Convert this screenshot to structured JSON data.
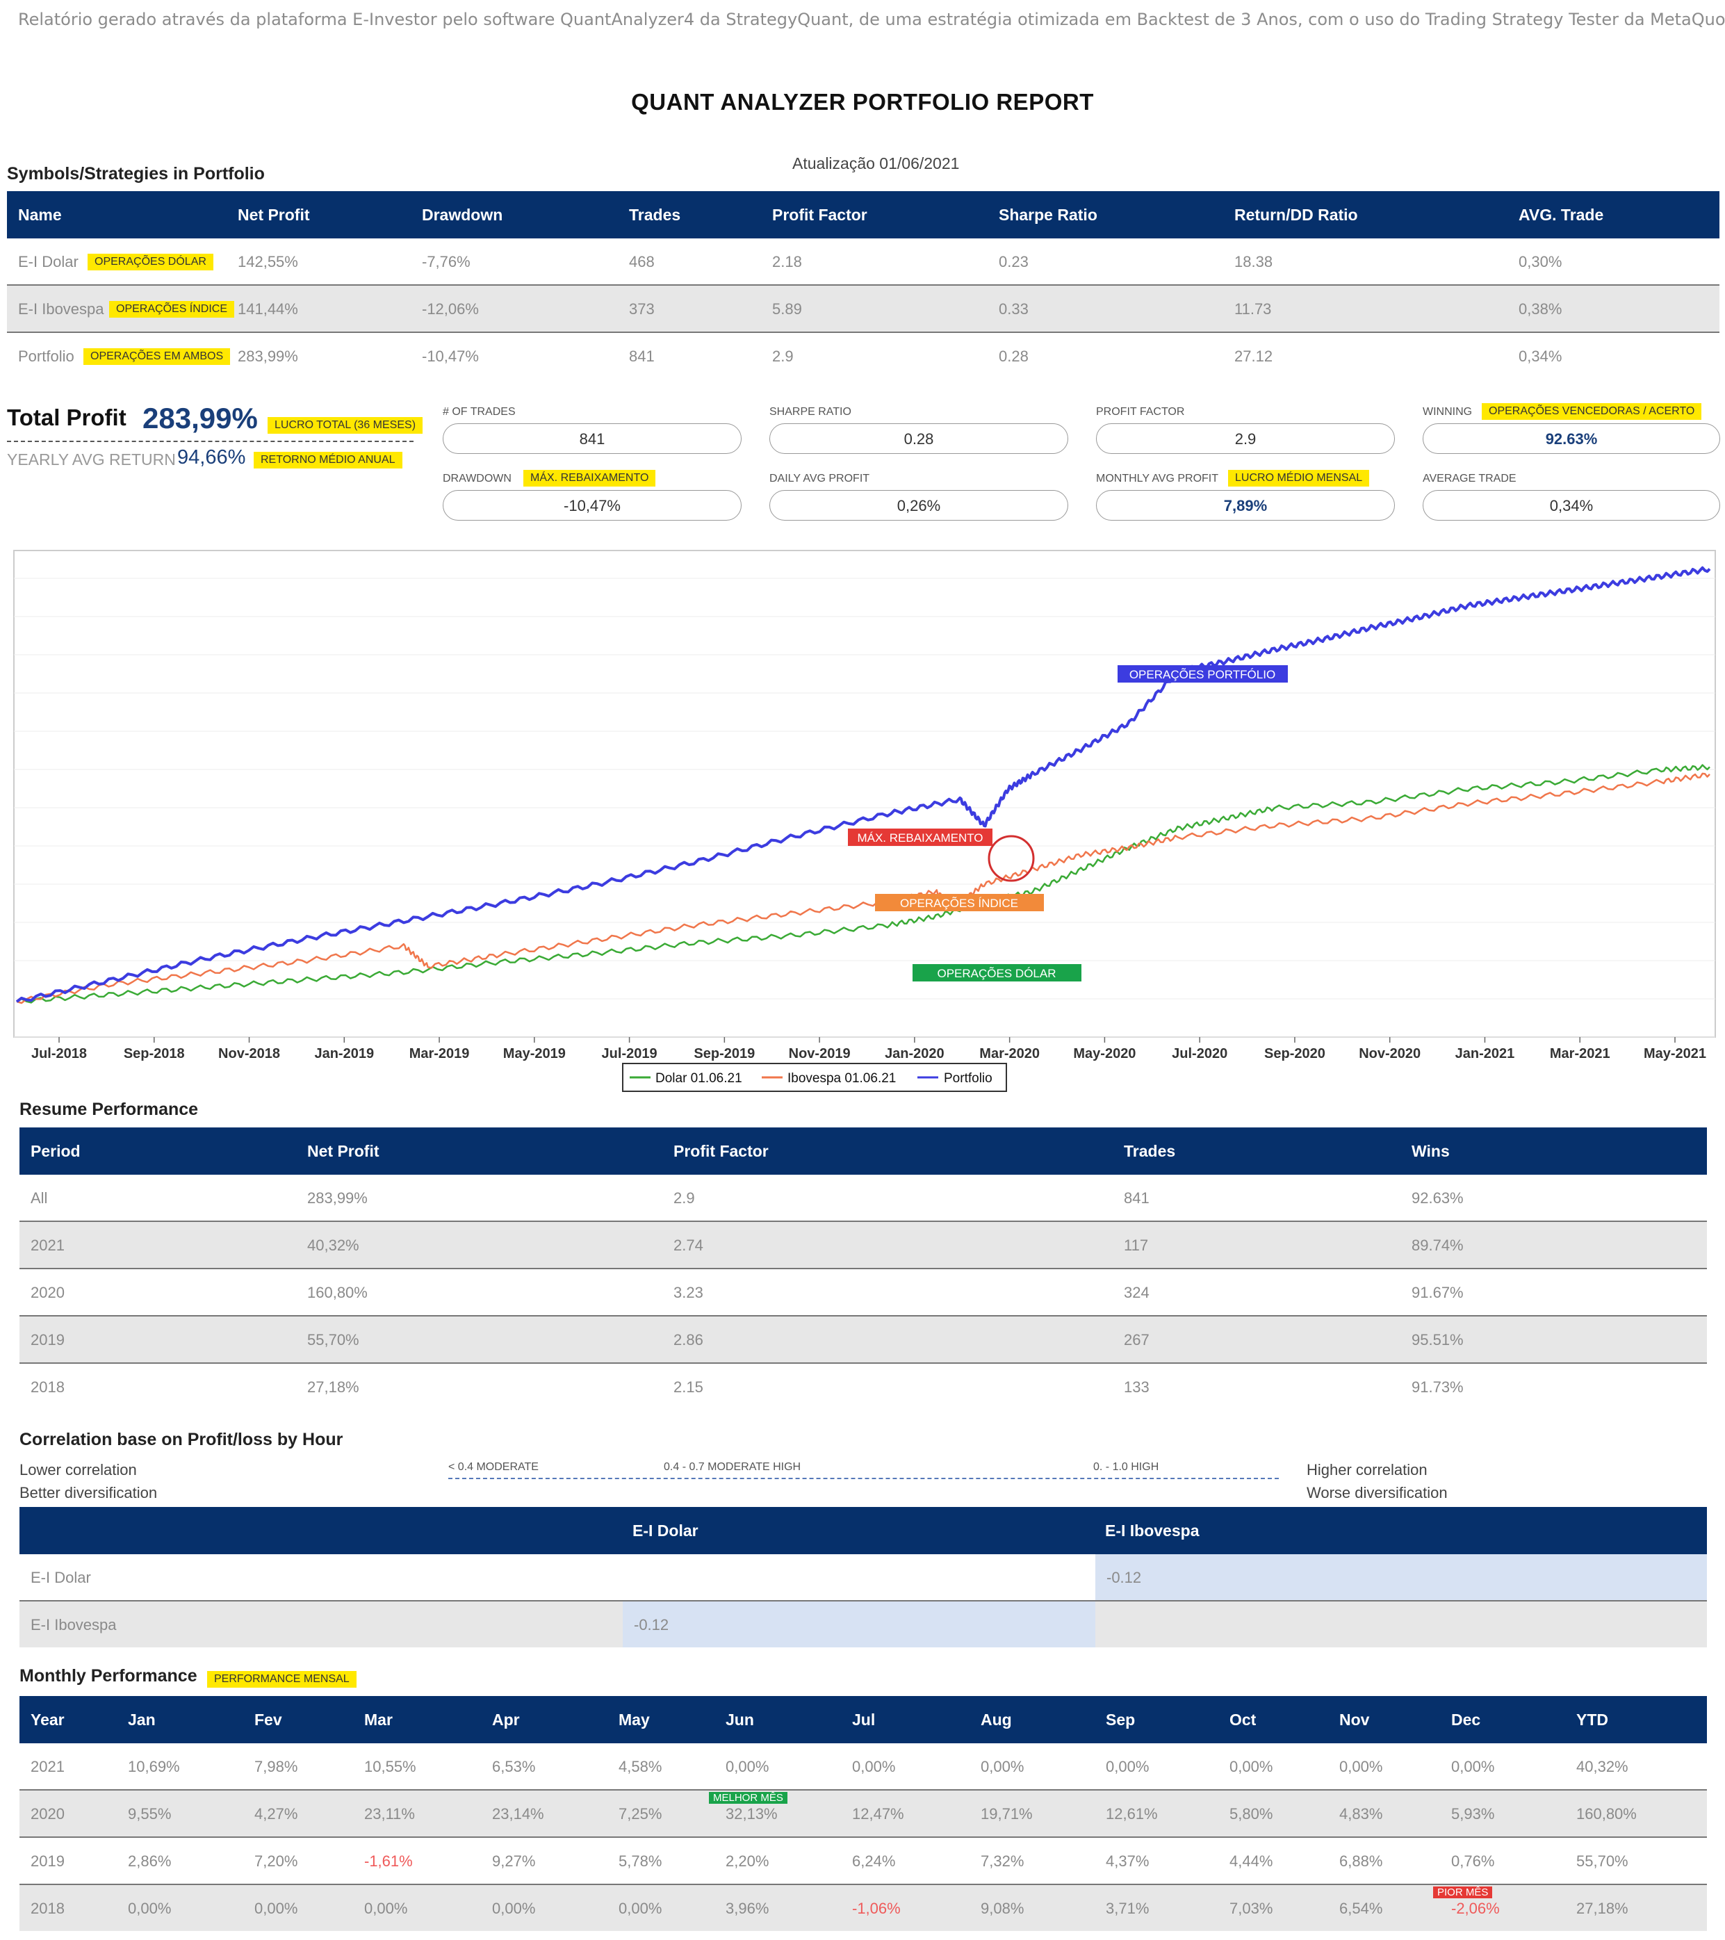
{
  "top_note": "Relatório gerado através da plataforma E-Investor pelo software QuantAnalyzer4 da StrategyQuant, de uma estratégia otimizada em Backtest de 3 Anos, com o uso do Trading Strategy Tester da MetaQuotes.",
  "report_title": "QUANT ANALYZER PORTFOLIO REPORT",
  "update_label": "Atualização 01/06/2021",
  "symbols_section": {
    "title": "Symbols/Strategies in Portfolio",
    "headers": [
      "Name",
      "Net Profit",
      "Drawdown",
      "Trades",
      "Profit Factor",
      "Sharpe Ratio",
      "Return/DD Ratio",
      "AVG. Trade"
    ],
    "rows": [
      {
        "name": "E-I Dolar",
        "tag": "OPERAÇÕES DÓLAR",
        "cells": [
          "142,55%",
          "-7,76%",
          "468",
          "2.18",
          "0.23",
          "18.38",
          "0,30%"
        ]
      },
      {
        "name": "E-I Ibovespa",
        "tag": "OPERAÇÕES ÍNDICE",
        "cells": [
          "141,44%",
          "-12,06%",
          "373",
          "5.89",
          "0.33",
          "11.73",
          "0,38%"
        ]
      },
      {
        "name": "Portfolio",
        "tag": "OPERAÇÕES EM AMBOS",
        "cells": [
          "283,99%",
          "-10,47%",
          "841",
          "2.9",
          "0.28",
          "27.12",
          "0,34%"
        ]
      }
    ]
  },
  "summary": {
    "total_profit_label": "Total Profit",
    "total_profit_value": "283,99%",
    "total_profit_tag": "LUCRO TOTAL (36 MESES)",
    "yearly_label": "YEARLY AVG RETURN",
    "yearly_value": "94,66%",
    "yearly_tag": "RETORNO MÉDIO ANUAL",
    "stats": [
      {
        "label": "# OF TRADES",
        "tag": "",
        "value": "841"
      },
      {
        "label": "SHARPE RATIO",
        "tag": "",
        "value": "0.28"
      },
      {
        "label": "PROFIT FACTOR",
        "tag": "",
        "value": "2.9"
      },
      {
        "label": "WINNING",
        "tag": "OPERAÇÕES VENCEDORAS / ACERTO",
        "value": "92.63%"
      },
      {
        "label": "DRAWDOWN",
        "tag": "MÁX. REBAIXAMENTO",
        "value": "-10,47%"
      },
      {
        "label": "DAILY AVG PROFIT",
        "tag": "",
        "value": "0,26%"
      },
      {
        "label": "MONTHLY AVG PROFIT",
        "tag": "LUCRO MÉDIO MENSAL",
        "value": "7,89%"
      },
      {
        "label": "AVERAGE TRADE",
        "tag": "",
        "value": "0,34%"
      }
    ]
  },
  "chart_data": {
    "type": "line",
    "x_ticks": [
      "Jul-2018",
      "Sep-2018",
      "Nov-2018",
      "Jan-2019",
      "Mar-2019",
      "May-2019",
      "Jul-2019",
      "Sep-2019",
      "Nov-2019",
      "Jan-2020",
      "Mar-2020",
      "May-2020",
      "Jul-2020",
      "Sep-2020",
      "Nov-2020",
      "Jan-2021",
      "Mar-2021",
      "May-2021"
    ],
    "x_range": [
      0,
      35
    ],
    "ylim": [
      -10,
      300
    ],
    "series": [
      {
        "name": "Dolar 01.06.21",
        "color": "#3aaa35",
        "x": [
          0,
          2,
          4,
          6,
          8,
          10,
          12,
          14,
          16,
          18,
          19,
          20,
          21,
          22,
          23,
          24,
          25,
          26,
          28,
          30,
          32,
          34,
          35
        ],
        "values": [
          0,
          5,
          10,
          15,
          20,
          27,
          33,
          40,
          45,
          52,
          58,
          68,
          75,
          90,
          105,
          118,
          125,
          132,
          136,
          145,
          150,
          158,
          160
        ]
      },
      {
        "name": "Ibovespa 01.06.21",
        "color": "#f0764b",
        "x": [
          0,
          2,
          4,
          6,
          8,
          8.5,
          10,
          12,
          14,
          16,
          18,
          19,
          19.4,
          20,
          21,
          22,
          23,
          24,
          26,
          28,
          30,
          32,
          34,
          35
        ],
        "values": [
          0,
          12,
          20,
          28,
          38,
          24,
          32,
          42,
          52,
          60,
          68,
          75,
          65,
          80,
          90,
          100,
          105,
          112,
          120,
          125,
          135,
          142,
          150,
          155
        ]
      },
      {
        "name": "Portfolio",
        "color": "#3c3ce0",
        "x": [
          0,
          2,
          4,
          6,
          8,
          10,
          12,
          14,
          16,
          18,
          19.5,
          20,
          20.5,
          21,
          22,
          23,
          24,
          25,
          26,
          27,
          28,
          29,
          30,
          31,
          32,
          33,
          34,
          35
        ],
        "values": [
          0,
          15,
          30,
          43,
          55,
          67,
          80,
          95,
          112,
          128,
          138,
          120,
          145,
          155,
          172,
          190,
          225,
          232,
          240,
          247,
          255,
          262,
          270,
          275,
          280,
          285,
          290,
          295
        ]
      }
    ],
    "legend": [
      "Dolar 01.06.21",
      "Ibovespa 01.06.21",
      "Portfolio"
    ],
    "annotations": [
      {
        "text": "OPERAÇÕES PORTFÓLIO",
        "color": "#3c3ce0"
      },
      {
        "text": "MÁX. REBAIXAMENTO",
        "color": "#e53935"
      },
      {
        "text": "OPERAÇÕES ÍNDICE",
        "color": "#f28a3a"
      },
      {
        "text": "OPERAÇÕES DÓLAR",
        "color": "#19a34a"
      }
    ]
  },
  "resume": {
    "title": "Resume Performance",
    "headers": [
      "Period",
      "Net Profit",
      "Profit Factor",
      "Trades",
      "Wins"
    ],
    "rows": [
      [
        "All",
        "283,99%",
        "2.9",
        "841",
        "92.63%"
      ],
      [
        "2021",
        "40,32%",
        "2.74",
        "117",
        "89.74%"
      ],
      [
        "2020",
        "160,80%",
        "3.23",
        "324",
        "91.67%"
      ],
      [
        "2019",
        "55,70%",
        "2.86",
        "267",
        "95.51%"
      ],
      [
        "2018",
        "27,18%",
        "2.15",
        "133",
        "91.73%"
      ]
    ]
  },
  "correlation": {
    "title": "Correlation base on Profit/loss by Hour",
    "lower_1": "Lower correlation",
    "lower_2": "Better diversification",
    "higher_1": "Higher correlation",
    "higher_2": "Worse diversification",
    "scale": [
      "< 0.4 MODERATE",
      "0.4 - 0.7 MODERATE HIGH",
      "0. - 1.0 HIGH"
    ],
    "headers": [
      "E-I Dolar",
      "E-I Ibovespa"
    ],
    "rows": [
      {
        "name": "E-I Dolar",
        "value": "-0.12"
      },
      {
        "name": "E-I Ibovespa",
        "value": "-0.12"
      }
    ]
  },
  "monthly": {
    "title": "Monthly Performance",
    "tag": "PERFORMANCE MENSAL",
    "headers": [
      "Year",
      "Jan",
      "Fev",
      "Mar",
      "Apr",
      "May",
      "Jun",
      "Jul",
      "Aug",
      "Sep",
      "Oct",
      "Nov",
      "Dec",
      "YTD"
    ],
    "rows": [
      [
        "2021",
        "10,69%",
        "7,98%",
        "10,55%",
        "6,53%",
        "4,58%",
        "0,00%",
        "0,00%",
        "0,00%",
        "0,00%",
        "0,00%",
        "0,00%",
        "0,00%",
        "40,32%"
      ],
      [
        "2020",
        "9,55%",
        "4,27%",
        "23,11%",
        "23,14%",
        "7,25%",
        "32,13%",
        "12,47%",
        "19,71%",
        "12,61%",
        "5,80%",
        "4,83%",
        "5,93%",
        "160,80%"
      ],
      [
        "2019",
        "2,86%",
        "7,20%",
        "-1,61%",
        "9,27%",
        "5,78%",
        "2,20%",
        "6,24%",
        "7,32%",
        "4,37%",
        "4,44%",
        "6,88%",
        "0,76%",
        "55,70%"
      ],
      [
        "2018",
        "0,00%",
        "0,00%",
        "0,00%",
        "0,00%",
        "0,00%",
        "3,96%",
        "-1,06%",
        "9,08%",
        "3,71%",
        "7,03%",
        "6,54%",
        "-2,06%",
        "27,18%"
      ]
    ],
    "best_label": "MELHOR MÊS",
    "worst_label": "PIOR MÊS"
  },
  "colors": {
    "header_navy": "#06306b",
    "highlight_yellow": "#ffe800",
    "negative_red": "#ef5a5a"
  }
}
